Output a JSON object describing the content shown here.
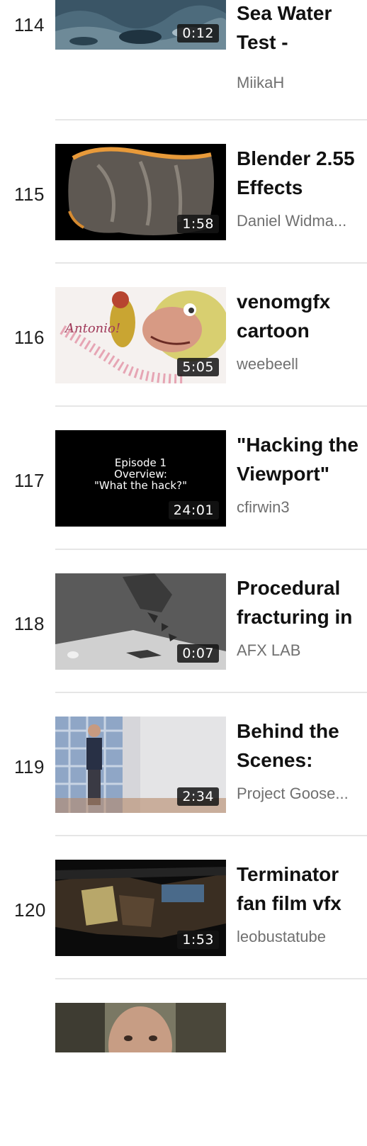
{
  "videos": [
    {
      "index": "114",
      "duration": "0:12",
      "title": "Sea Water Test -",
      "channel": "MiikaH"
    },
    {
      "index": "115",
      "duration": "1:58",
      "title": "Blender 2.55 Effects",
      "channel": "Daniel Widma..."
    },
    {
      "index": "116",
      "duration": "5:05",
      "title": "venomgfx cartoon",
      "channel": "weebeell",
      "thumb_text": "Antonio!"
    },
    {
      "index": "117",
      "duration": "24:01",
      "title": "\"Hacking the Viewport\"",
      "channel": "cfirwin3",
      "thumb_lines": [
        "Episode 1",
        "Overview:",
        "\"What the hack?\""
      ]
    },
    {
      "index": "118",
      "duration": "0:07",
      "title": "Procedural fracturing in",
      "channel": "AFX LAB"
    },
    {
      "index": "119",
      "duration": "2:34",
      "title": "Behind the Scenes:",
      "channel": "Project Goose..."
    },
    {
      "index": "120",
      "duration": "1:53",
      "title": "Terminator fan film vfx",
      "channel": "leobustatube"
    }
  ]
}
